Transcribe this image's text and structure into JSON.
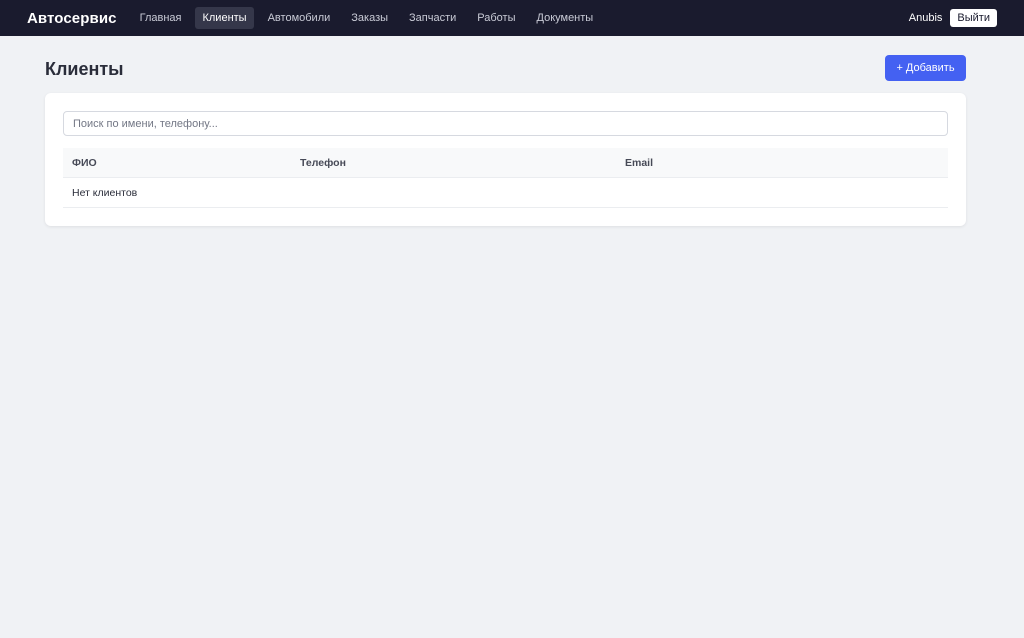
{
  "navbar": {
    "brand": "Автосервис",
    "items": [
      {
        "label": "Главная",
        "active": false
      },
      {
        "label": "Клиенты",
        "active": true
      },
      {
        "label": "Автомобили",
        "active": false
      },
      {
        "label": "Заказы",
        "active": false
      },
      {
        "label": "Запчасти",
        "active": false
      },
      {
        "label": "Работы",
        "active": false
      },
      {
        "label": "Документы",
        "active": false
      }
    ],
    "user_name": "Anubis",
    "logout_label": "Выйти"
  },
  "page": {
    "title": "Клиенты",
    "add_label": "+ Добавить"
  },
  "search": {
    "placeholder": "Поиск по имени, телефону...",
    "value": ""
  },
  "table": {
    "columns": [
      "ФИО",
      "Телефон",
      "Email"
    ],
    "empty_message": "Нет клиентов"
  },
  "colors": {
    "navbar_bg": "#1a1b2e",
    "accent": "#4461f2",
    "page_bg": "#f0f2f5"
  }
}
